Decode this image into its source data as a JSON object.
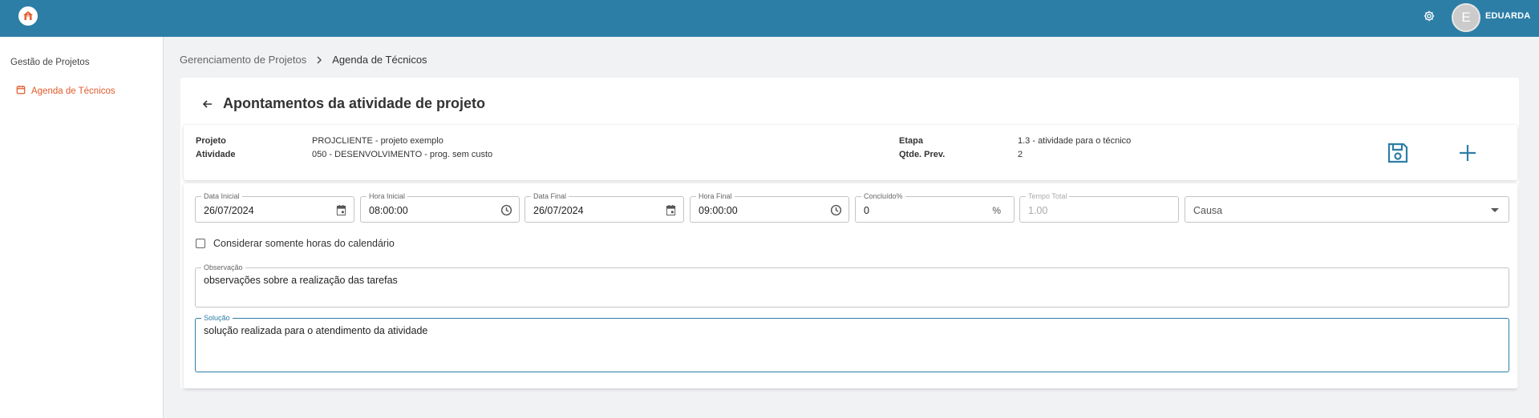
{
  "header": {
    "logo_icon": "house-logo-icon",
    "settings_icon": "gear-icon",
    "avatar_initial": "E",
    "username": "EDUARDA",
    "brand_color": "#2d7ea6"
  },
  "sidebar": {
    "section_title": "Gestão de Projetos",
    "items": [
      {
        "label": "Agenda de Técnicos",
        "icon": "calendar-icon",
        "active": true
      }
    ]
  },
  "breadcrumb": {
    "items": [
      "Gerenciamento de Projetos",
      "Agenda de Técnicos"
    ]
  },
  "page": {
    "title": "Apontamentos da atividade de projeto"
  },
  "project_info": {
    "projeto_label": "Projeto",
    "projeto_value": "PROJCLIENTE - projeto exemplo",
    "atividade_label": "Atividade",
    "atividade_value": "050 - DESENVOLVIMENTO - prog. sem custo",
    "etapa_label": "Etapa",
    "etapa_value": "1.3 - atividade para o técnico",
    "qtde_label": "Qtde. Prev.",
    "qtde_value": "2"
  },
  "form": {
    "data_inicial": {
      "label": "Data Inicial",
      "value": "26/07/2024"
    },
    "hora_inicial": {
      "label": "Hora Inicial",
      "value": "08:00:00"
    },
    "data_final": {
      "label": "Data Final",
      "value": "26/07/2024"
    },
    "hora_final": {
      "label": "Hora Final",
      "value": "09:00:00"
    },
    "concluido": {
      "label": "Concluído%",
      "value": "0",
      "suffix": "%"
    },
    "tempo_total": {
      "label": "Tempo Total",
      "value": "1.00"
    },
    "causa": {
      "placeholder": "Causa"
    },
    "checkbox_label": "Considerar somente horas do calendário",
    "checkbox_checked": false,
    "observacao": {
      "label": "Observação",
      "value": "observações sobre a realização das tarefas"
    },
    "solucao": {
      "label": "Solução",
      "value": "solução realizada para o atendimento da atividade"
    }
  }
}
